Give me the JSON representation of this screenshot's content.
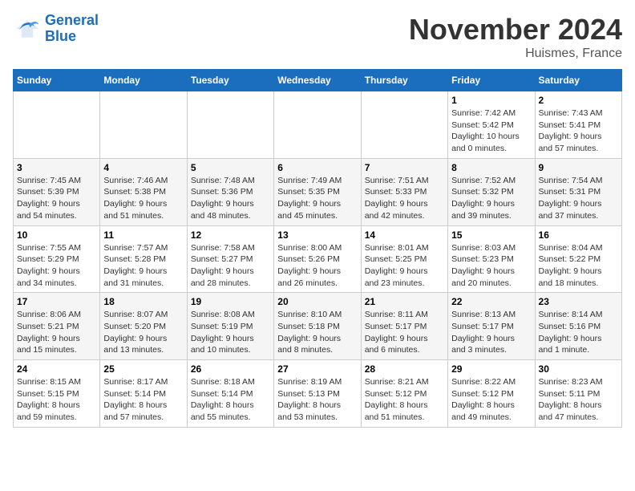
{
  "logo": {
    "line1": "General",
    "line2": "Blue"
  },
  "title": "November 2024",
  "location": "Huismes, France",
  "days_of_week": [
    "Sunday",
    "Monday",
    "Tuesday",
    "Wednesday",
    "Thursday",
    "Friday",
    "Saturday"
  ],
  "weeks": [
    [
      {
        "day": "",
        "info": ""
      },
      {
        "day": "",
        "info": ""
      },
      {
        "day": "",
        "info": ""
      },
      {
        "day": "",
        "info": ""
      },
      {
        "day": "",
        "info": ""
      },
      {
        "day": "1",
        "info": "Sunrise: 7:42 AM\nSunset: 5:42 PM\nDaylight: 10 hours\nand 0 minutes."
      },
      {
        "day": "2",
        "info": "Sunrise: 7:43 AM\nSunset: 5:41 PM\nDaylight: 9 hours\nand 57 minutes."
      }
    ],
    [
      {
        "day": "3",
        "info": "Sunrise: 7:45 AM\nSunset: 5:39 PM\nDaylight: 9 hours\nand 54 minutes."
      },
      {
        "day": "4",
        "info": "Sunrise: 7:46 AM\nSunset: 5:38 PM\nDaylight: 9 hours\nand 51 minutes."
      },
      {
        "day": "5",
        "info": "Sunrise: 7:48 AM\nSunset: 5:36 PM\nDaylight: 9 hours\nand 48 minutes."
      },
      {
        "day": "6",
        "info": "Sunrise: 7:49 AM\nSunset: 5:35 PM\nDaylight: 9 hours\nand 45 minutes."
      },
      {
        "day": "7",
        "info": "Sunrise: 7:51 AM\nSunset: 5:33 PM\nDaylight: 9 hours\nand 42 minutes."
      },
      {
        "day": "8",
        "info": "Sunrise: 7:52 AM\nSunset: 5:32 PM\nDaylight: 9 hours\nand 39 minutes."
      },
      {
        "day": "9",
        "info": "Sunrise: 7:54 AM\nSunset: 5:31 PM\nDaylight: 9 hours\nand 37 minutes."
      }
    ],
    [
      {
        "day": "10",
        "info": "Sunrise: 7:55 AM\nSunset: 5:29 PM\nDaylight: 9 hours\nand 34 minutes."
      },
      {
        "day": "11",
        "info": "Sunrise: 7:57 AM\nSunset: 5:28 PM\nDaylight: 9 hours\nand 31 minutes."
      },
      {
        "day": "12",
        "info": "Sunrise: 7:58 AM\nSunset: 5:27 PM\nDaylight: 9 hours\nand 28 minutes."
      },
      {
        "day": "13",
        "info": "Sunrise: 8:00 AM\nSunset: 5:26 PM\nDaylight: 9 hours\nand 26 minutes."
      },
      {
        "day": "14",
        "info": "Sunrise: 8:01 AM\nSunset: 5:25 PM\nDaylight: 9 hours\nand 23 minutes."
      },
      {
        "day": "15",
        "info": "Sunrise: 8:03 AM\nSunset: 5:23 PM\nDaylight: 9 hours\nand 20 minutes."
      },
      {
        "day": "16",
        "info": "Sunrise: 8:04 AM\nSunset: 5:22 PM\nDaylight: 9 hours\nand 18 minutes."
      }
    ],
    [
      {
        "day": "17",
        "info": "Sunrise: 8:06 AM\nSunset: 5:21 PM\nDaylight: 9 hours\nand 15 minutes."
      },
      {
        "day": "18",
        "info": "Sunrise: 8:07 AM\nSunset: 5:20 PM\nDaylight: 9 hours\nand 13 minutes."
      },
      {
        "day": "19",
        "info": "Sunrise: 8:08 AM\nSunset: 5:19 PM\nDaylight: 9 hours\nand 10 minutes."
      },
      {
        "day": "20",
        "info": "Sunrise: 8:10 AM\nSunset: 5:18 PM\nDaylight: 9 hours\nand 8 minutes."
      },
      {
        "day": "21",
        "info": "Sunrise: 8:11 AM\nSunset: 5:17 PM\nDaylight: 9 hours\nand 6 minutes."
      },
      {
        "day": "22",
        "info": "Sunrise: 8:13 AM\nSunset: 5:17 PM\nDaylight: 9 hours\nand 3 minutes."
      },
      {
        "day": "23",
        "info": "Sunrise: 8:14 AM\nSunset: 5:16 PM\nDaylight: 9 hours\nand 1 minute."
      }
    ],
    [
      {
        "day": "24",
        "info": "Sunrise: 8:15 AM\nSunset: 5:15 PM\nDaylight: 8 hours\nand 59 minutes."
      },
      {
        "day": "25",
        "info": "Sunrise: 8:17 AM\nSunset: 5:14 PM\nDaylight: 8 hours\nand 57 minutes."
      },
      {
        "day": "26",
        "info": "Sunrise: 8:18 AM\nSunset: 5:14 PM\nDaylight: 8 hours\nand 55 minutes."
      },
      {
        "day": "27",
        "info": "Sunrise: 8:19 AM\nSunset: 5:13 PM\nDaylight: 8 hours\nand 53 minutes."
      },
      {
        "day": "28",
        "info": "Sunrise: 8:21 AM\nSunset: 5:12 PM\nDaylight: 8 hours\nand 51 minutes."
      },
      {
        "day": "29",
        "info": "Sunrise: 8:22 AM\nSunset: 5:12 PM\nDaylight: 8 hours\nand 49 minutes."
      },
      {
        "day": "30",
        "info": "Sunrise: 8:23 AM\nSunset: 5:11 PM\nDaylight: 8 hours\nand 47 minutes."
      }
    ]
  ]
}
